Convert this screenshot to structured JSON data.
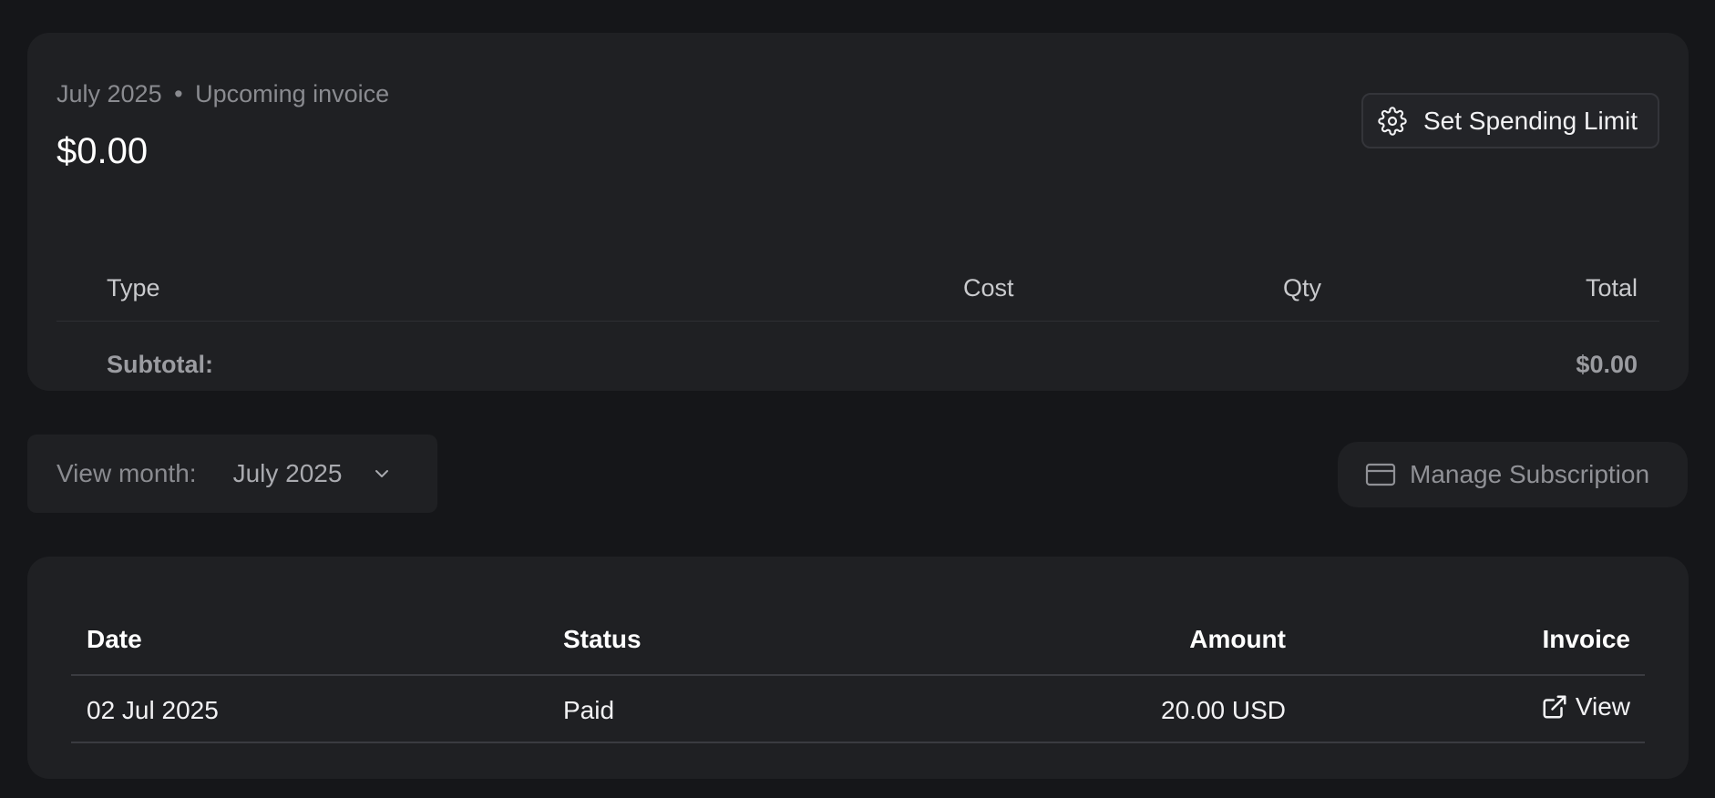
{
  "invoice": {
    "month": "July 2025",
    "separator": "•",
    "label": "Upcoming invoice",
    "amount": "$0.00",
    "spend_button_label": "Set Spending Limit",
    "table": {
      "headers": {
        "type": "Type",
        "cost": "Cost",
        "qty": "Qty",
        "total": "Total"
      },
      "subtotal_label": "Subtotal:",
      "subtotal_value": "$0.00"
    }
  },
  "controls": {
    "view_month_label": "View month:",
    "view_month_value": "July 2025",
    "manage_subscription_label": "Manage Subscription"
  },
  "history": {
    "headers": {
      "date": "Date",
      "status": "Status",
      "amount": "Amount",
      "invoice": "Invoice"
    },
    "rows": [
      {
        "date": "02 Jul 2025",
        "status": "Paid",
        "amount": "20.00 USD",
        "invoice_link": "View"
      }
    ]
  },
  "icons": {
    "spend": "gear-icon",
    "month_dropdown": "chevron-down-icon",
    "subscription": "credit-card-icon",
    "invoice_link": "external-link-icon"
  },
  "colors": {
    "background": "#151619",
    "card": "#1f2023",
    "muted_text": "#8a8b90",
    "primary_text": "#ffffff"
  }
}
